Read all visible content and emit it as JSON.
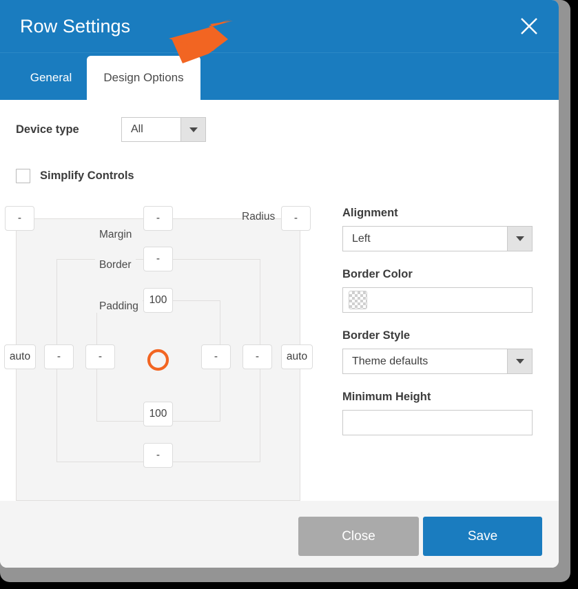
{
  "header": {
    "title": "Row Settings",
    "close_icon": "close-icon",
    "accent_color": "#1a7cbf"
  },
  "tabs": [
    {
      "label": "General",
      "active": false,
      "name": "tab-general"
    },
    {
      "label": "Design Options",
      "active": true,
      "name": "tab-design-options"
    }
  ],
  "annotation": {
    "type": "arrow",
    "color": "#f26522",
    "points_to": "Design Options tab"
  },
  "body": {
    "device_type": {
      "label": "Device type",
      "value": "All",
      "icon": "chevron-down-icon"
    },
    "simplify_controls": {
      "label": "Simplify Controls",
      "checked": false
    },
    "box_model": {
      "labels": {
        "margin": "Margin",
        "border": "Border",
        "padding": "Padding",
        "radius": "Radius"
      },
      "center_icon": "orange-ring-spinner-icon",
      "center_icon_color": "#f26522",
      "values": {
        "margin_top_left": "-",
        "margin_top": "-",
        "radius_top_right": "-",
        "border_top": "-",
        "padding_top": "100",
        "margin_left": "auto",
        "border_left": "-",
        "padding_left": "-",
        "padding_right": "-",
        "border_right": "-",
        "margin_right": "auto",
        "padding_bottom": "100",
        "border_bottom": "-"
      }
    },
    "settings": {
      "alignment": {
        "label": "Alignment",
        "value": "Left",
        "icon": "chevron-down-icon"
      },
      "border_color": {
        "label": "Border Color",
        "value": "",
        "swatch": "transparent"
      },
      "border_style": {
        "label": "Border Style",
        "value": "Theme defaults",
        "icon": "chevron-down-icon"
      },
      "minimum_height": {
        "label": "Minimum Height",
        "value": "",
        "placeholder": ""
      }
    }
  },
  "footer": {
    "close_label": "Close",
    "save_label": "Save",
    "close_color": "#aaaaaa",
    "save_color": "#1a7cbf"
  }
}
